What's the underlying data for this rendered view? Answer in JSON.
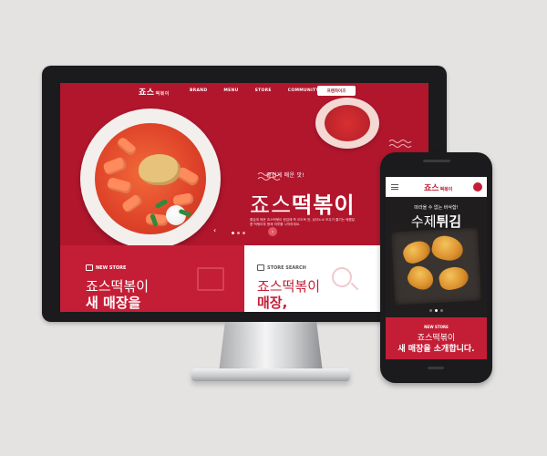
{
  "desktop": {
    "logo": "죠스",
    "logo_sub": "떡볶이",
    "menu": [
      "BRAND",
      "MENU",
      "STORE",
      "COMMUNITY"
    ],
    "order_button": "프랜차이즈",
    "hero": {
      "tagline": "즐겁게 매운 맛!",
      "title_thin": "죠스",
      "title_bold": "떡볶이",
      "description": "즐겁게 매운 죠스떡볶이 한입에 쏙 오도독 맛, 남녀노소 모두가 즐기는 매콤달콤 떡볶이와 함께 하루를 시작하세요."
    },
    "new_store": {
      "label": "NEW STORE",
      "line1": "죠스떡볶이",
      "line2": "새 매장을"
    },
    "store_search": {
      "label": "STORE SEARCH",
      "line1": "죠스떡볶이",
      "line2": "매장,"
    }
  },
  "mobile": {
    "logo": "죠스",
    "logo_sub": "떡볶이",
    "hero_sub": "따라올 수 없는 바삭함!",
    "hero_title_thin": "수제",
    "hero_title_bold": "튀김",
    "store_label": "NEW STORE",
    "store_line1": "죠스떡볶이",
    "store_line2": "새 매장을 소개합니다."
  },
  "colors": {
    "brand_red": "#b1162d",
    "store_red": "#c41e36",
    "background": "#e4e3e1"
  }
}
